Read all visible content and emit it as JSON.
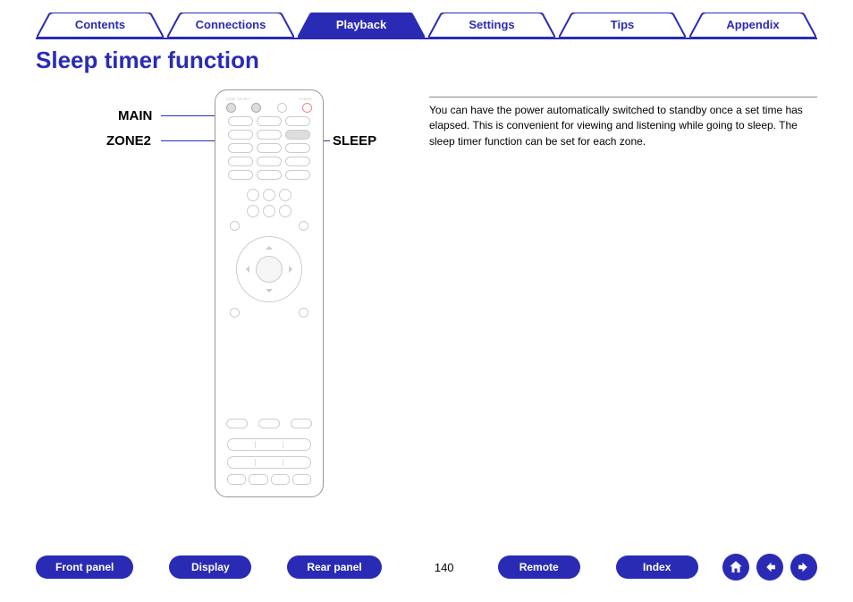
{
  "tabs": {
    "contents": "Contents",
    "connections": "Connections",
    "playback": "Playback",
    "settings": "Settings",
    "tips": "Tips",
    "appendix": "Appendix"
  },
  "title": "Sleep timer function",
  "callouts": {
    "main": "MAIN",
    "zone2": "ZONE2",
    "sleep": "SLEEP"
  },
  "body_text": "You can have the power automatically switched to standby once a set time has elapsed. This is convenient for viewing and listening while going to sleep. The sleep timer function can be set for each zone.",
  "footer": {
    "front_panel": "Front panel",
    "display": "Display",
    "rear_panel": "Rear panel",
    "remote": "Remote",
    "index": "Index"
  },
  "page_number": "140",
  "colors": {
    "brand": "#2a2bb5"
  },
  "icons": {
    "home": "home-icon",
    "prev": "arrow-left-icon",
    "next": "arrow-right-icon"
  },
  "remote_labels": {
    "zone_select": "ZONE SELECT",
    "power": "POWER"
  }
}
